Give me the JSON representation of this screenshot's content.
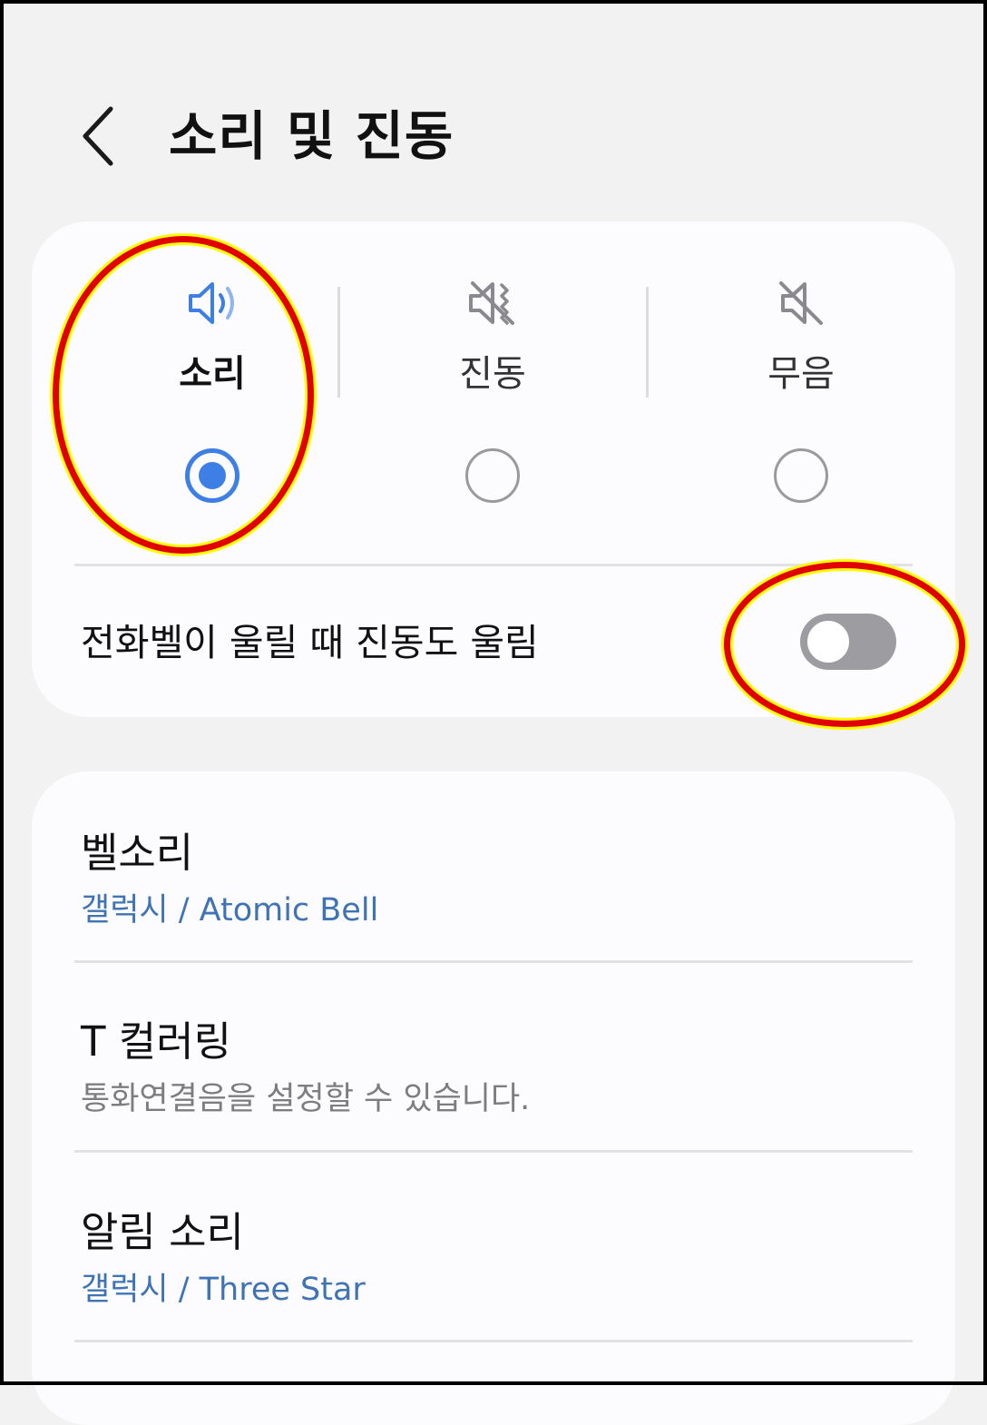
{
  "header": {
    "title": "소리 및 진동"
  },
  "sound_mode": {
    "options": [
      {
        "label": "소리",
        "icon": "speaker-volume-icon",
        "selected": true
      },
      {
        "label": "진동",
        "icon": "vibrate-icon",
        "selected": false
      },
      {
        "label": "무음",
        "icon": "mute-icon",
        "selected": false
      }
    ],
    "vibrate_while_ringing": {
      "label": "전화벨이 울릴 때 진동도 울림",
      "on": false
    }
  },
  "settings": {
    "items": [
      {
        "title": "벨소리",
        "subtitle": "갤럭시 / Atomic Bell"
      },
      {
        "title": "T 컬러링",
        "subtitle": "통화연결음을 설정할 수 있습니다."
      },
      {
        "title": "알림 소리",
        "subtitle": "갤럭시 / Three Star"
      }
    ]
  },
  "colors": {
    "accent": "#3e7fe6",
    "subtitle_link": "#3f73b4",
    "annotation": "#e10000",
    "annotation_outline": "#ffff00"
  }
}
